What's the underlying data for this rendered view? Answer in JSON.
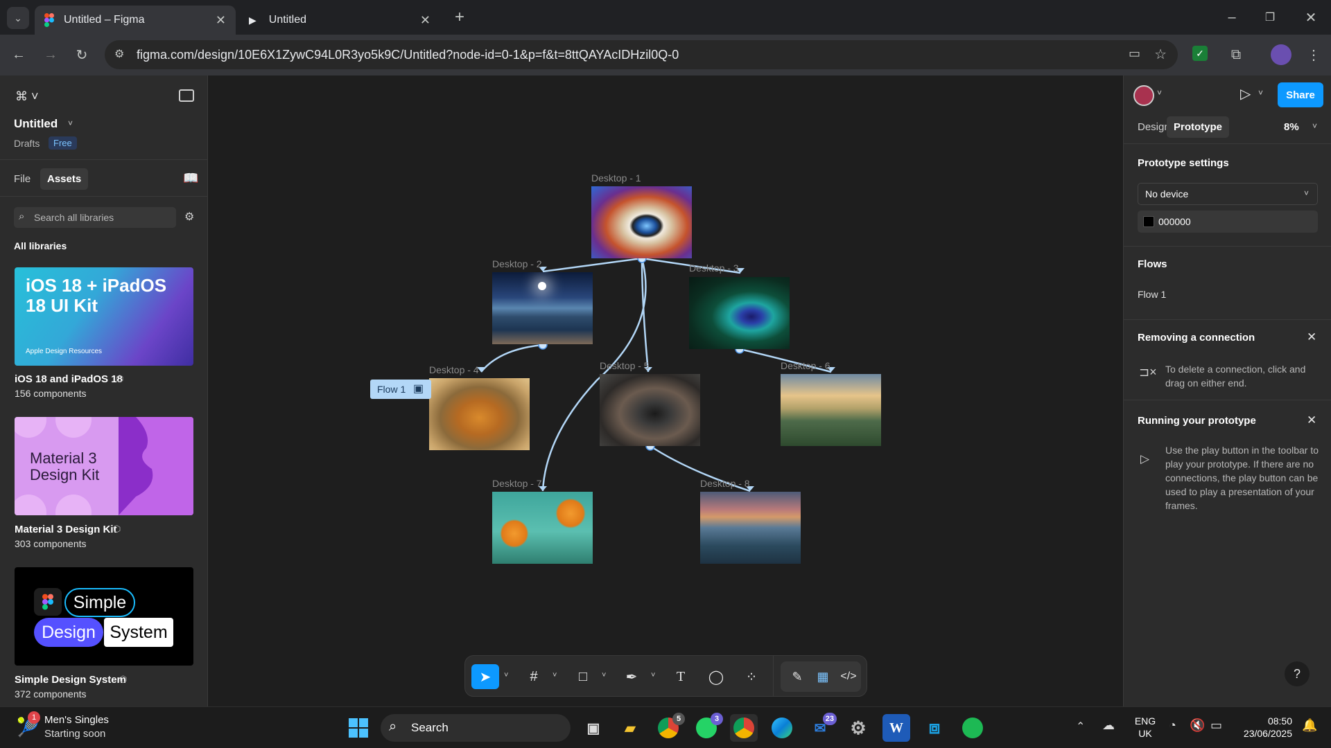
{
  "browser": {
    "tabs": [
      {
        "title": "Untitled – Figma",
        "active": true
      },
      {
        "title": "Untitled",
        "active": false
      }
    ],
    "url": "figma.com/design/10E6X1ZywC94L0R3yo5k9C/Untitled?node-id=0-1&p=f&t=8ttQAYAcIDHzil0Q-0"
  },
  "left_panel": {
    "file_name": "Untitled",
    "location": "Drafts",
    "plan_badge": "Free",
    "tabs": [
      "File",
      "Assets"
    ],
    "search_placeholder": "Search all libraries",
    "section_title": "All libraries",
    "libraries": [
      {
        "name": "iOS 18 and iPadOS 18",
        "count": "156 components",
        "thumb_title": "iOS 18 + iPadOS 18 UI Kit",
        "thumb_sub": "Apple Design Resources"
      },
      {
        "name": "Material 3 Design Kit",
        "count": "303 components",
        "thumb_title": "Material 3 Design Kit"
      },
      {
        "name": "Simple Design System",
        "count": "372 components",
        "thumb_words": [
          "Simple",
          "Design",
          "System"
        ]
      }
    ]
  },
  "canvas": {
    "frames": [
      {
        "label": "Desktop - 1"
      },
      {
        "label": "Desktop - 2"
      },
      {
        "label": "Desktop - 3"
      },
      {
        "label": "Desktop - 4"
      },
      {
        "label": "Desktop - 5"
      },
      {
        "label": "Desktop - 6"
      },
      {
        "label": "Desktop - 7"
      },
      {
        "label": "Desktop - 8"
      }
    ],
    "flow_tag": "Flow 1"
  },
  "right_panel": {
    "tabs": [
      "Design",
      "Prototype"
    ],
    "zoom": "8%",
    "share_label": "Share",
    "prototype_settings_title": "Prototype settings",
    "device_select": "No device",
    "background_color": "000000",
    "flows_title": "Flows",
    "flow_item": "Flow 1",
    "tip1_title": "Removing a connection",
    "tip1_text": "To delete a connection, click and drag on either end.",
    "tip2_title": "Running your prototype",
    "tip2_text": "Use the play button in the toolbar to play your prototype. If there are no connections, the play button can be used to play a presentation of your frames."
  },
  "taskbar": {
    "widget_title": "Men's Singles",
    "widget_sub": "Starting soon",
    "widget_badge": "1",
    "search_label": "Search",
    "chrome_badge": "5",
    "whatsapp_badge": "3",
    "mail_badge": "23",
    "lang": "ENG",
    "region": "UK",
    "time": "08:50",
    "date": "23/06/2025"
  },
  "colors": {
    "accent_blue": "#0d99ff",
    "connector": "#b3d7f7",
    "panel_bg": "#2c2c2c",
    "canvas_bg": "#1e1e1e"
  }
}
